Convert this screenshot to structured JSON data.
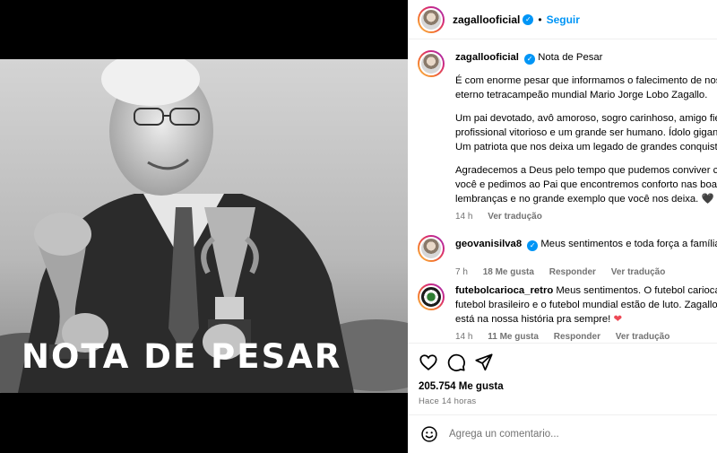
{
  "media": {
    "overlay_title": "NOTA DE PESAR"
  },
  "post": {
    "author": "zagallooficial",
    "follow_label": "Seguir",
    "dot": "•"
  },
  "caption": {
    "username": "zagallooficial",
    "lines": [
      "Nota de Pesar",
      "",
      "É com enorme pesar que informamos o falecimento de nosso",
      "eterno tetracampeão mundial Mario Jorge Lobo Zagallo.",
      "",
      "Um pai devotado, avô amoroso, sogro carinhoso, amigo fiel,",
      "profissional vitorioso e um grande ser humano. Ídolo gigante.",
      "Um patriota que nos deixa um legado de grandes conquistas.",
      "",
      "Agradecemos a Deus pelo tempo que pudemos conviver com",
      "você e pedimos ao Pai que encontremos conforto nas boas",
      "lembranças e no grande exemplo que você nos deixa."
    ],
    "heart": "🖤",
    "time": "14 h",
    "translate": "Ver tradução"
  },
  "comments": [
    {
      "username": "geovanisilva8",
      "text": "Meus sentimentos e toda força a família",
      "time": "7 h",
      "likes": "18 Me gusta",
      "reply": "Responder",
      "translate": "Ver tradução"
    },
    {
      "username": "futebolcarioca_retro",
      "lines": [
        "Meus sentimentos. O futebol carioca, o",
        "futebol brasileiro e o futebol mundial estão de luto. Zagallo",
        "está na nossa história pra sempre!"
      ],
      "heart": "❤",
      "time": "14 h",
      "likes": "11 Me gusta",
      "reply": "Responder",
      "translate": "Ver tradução"
    }
  ],
  "stats": {
    "likes": "205.754 Me gusta",
    "time": "Hace 14 horas"
  },
  "composer": {
    "placeholder": "Agrega un comentario..."
  }
}
